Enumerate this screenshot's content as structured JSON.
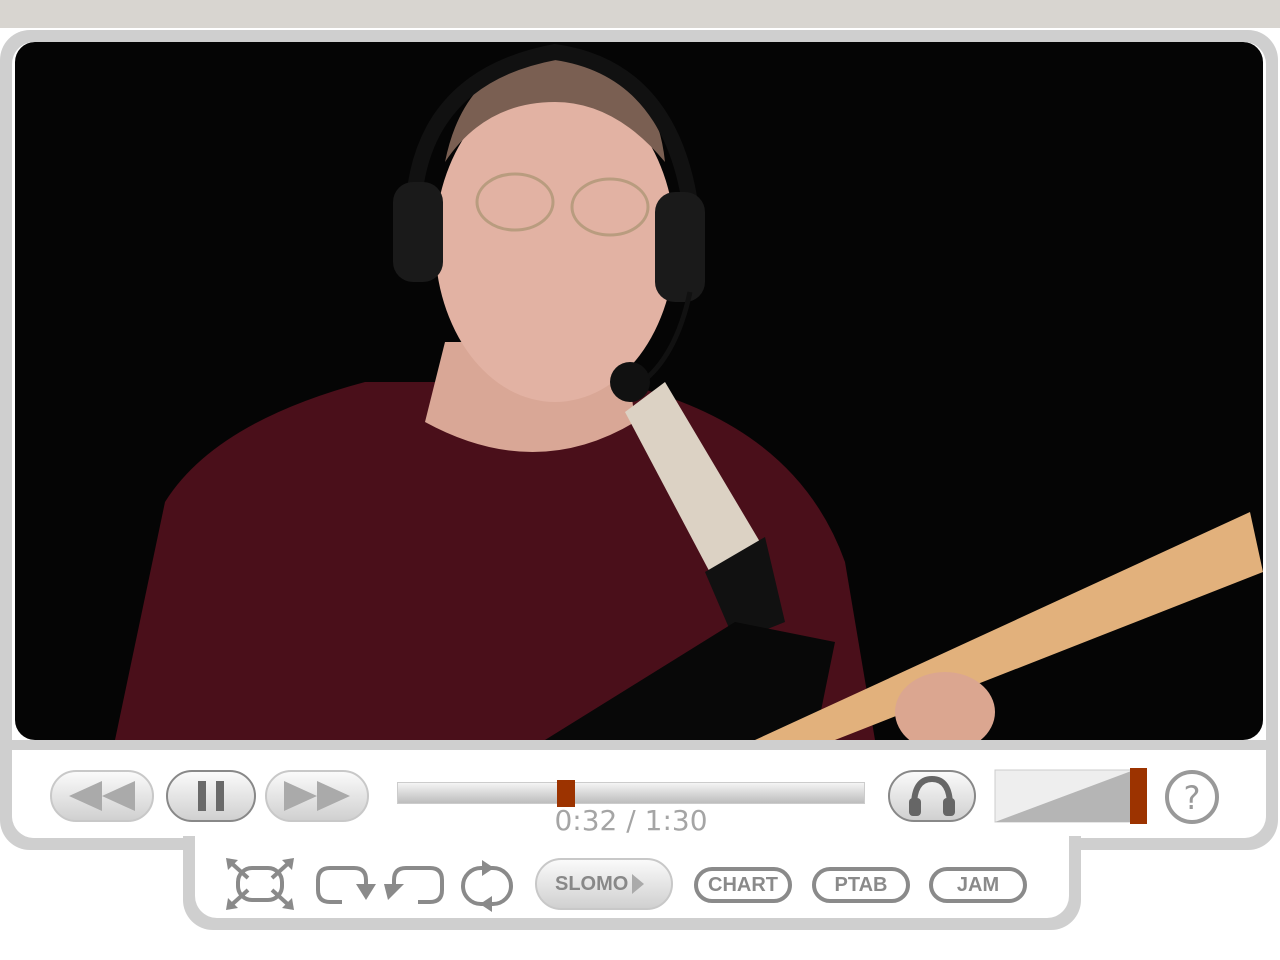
{
  "player": {
    "time_current": "0:32",
    "time_separator": "/",
    "time_total": "1:30",
    "progress_fraction": 0.356,
    "volume_fraction": 1.0,
    "accent_color": "#9c3300"
  },
  "controls": {
    "rewind_icon": "rewind-icon",
    "pause_icon": "pause-icon",
    "forward_icon": "fast-forward-icon",
    "audio_icon": "headphones-icon",
    "help_icon": "question-mark-icon"
  },
  "toolbar": {
    "slomo_label": "SLOMO",
    "chart_label": "CHART",
    "ptab_label": "PTAB",
    "jam_label": "JAM"
  }
}
